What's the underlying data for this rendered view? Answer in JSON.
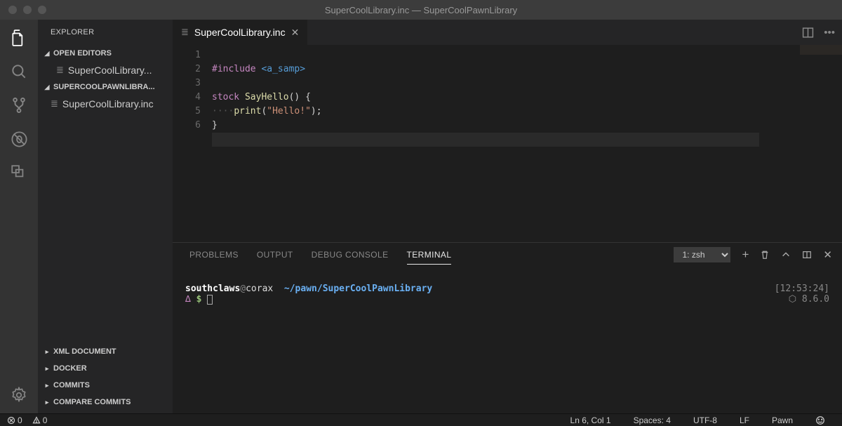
{
  "titlebar": {
    "title": "SuperCoolLibrary.inc — SuperCoolPawnLibrary"
  },
  "sidebar": {
    "title": "EXPLORER",
    "sections": {
      "open_editors": {
        "label": "OPEN EDITORS",
        "file": "SuperCoolLibrary..."
      },
      "project": {
        "label": "SUPERCOOLPAWNLIBRA...",
        "file": "SuperCoolLibrary.inc"
      },
      "xml": {
        "label": "XML DOCUMENT"
      },
      "docker": {
        "label": "DOCKER"
      },
      "commits": {
        "label": "COMMITS"
      },
      "compare": {
        "label": "COMPARE COMMITS"
      }
    }
  },
  "tab": {
    "filename": "SuperCoolLibrary.inc"
  },
  "editor": {
    "line_numbers": [
      "1",
      "2",
      "3",
      "4",
      "5",
      "6"
    ],
    "code": {
      "l1_kw": "#include",
      "l1_inc": "<a_samp>",
      "l3_kw": "stock",
      "l3_fn": "SayHello",
      "l3_rest": "() {",
      "l4_dots": "····",
      "l4_fn": "print",
      "l4_open": "(",
      "l4_str": "\"Hello!\"",
      "l4_close": ");",
      "l5": "}"
    }
  },
  "panel": {
    "tabs": {
      "problems": "PROBLEMS",
      "output": "OUTPUT",
      "debug": "DEBUG CONSOLE",
      "terminal": "TERMINAL"
    },
    "term_select": "1: zsh",
    "terminal": {
      "user": "southclaws",
      "host": "corax",
      "path": "~/pawn/SuperCoolPawnLibrary",
      "time": "[12:53:24]",
      "version": "⬡ 8.6.0",
      "delta": "∆",
      "dollar": "$"
    }
  },
  "statusbar": {
    "errors": "0",
    "warnings": "0",
    "position": "Ln 6, Col 1",
    "spaces": "Spaces: 4",
    "encoding": "UTF-8",
    "eol": "LF",
    "language": "Pawn"
  }
}
